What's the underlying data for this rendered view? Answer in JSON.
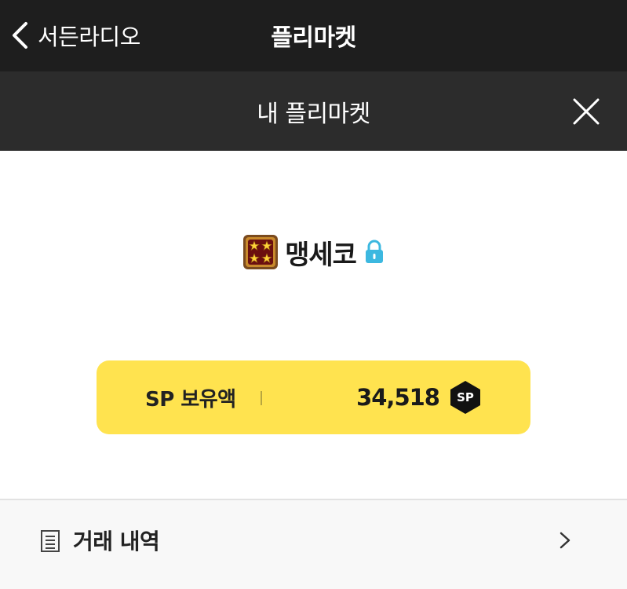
{
  "topbar": {
    "back_label": "서든라디오",
    "title": "플리마켓"
  },
  "subbar": {
    "title": "내 플리마켓"
  },
  "profile": {
    "grade_icon": "four-star-grade-icon",
    "nickname": "맹세코",
    "lock_icon": "lock-icon"
  },
  "sp_card": {
    "label": "SP 보유액",
    "value": "34,518",
    "badge_text": "SP"
  },
  "menu": {
    "history_label": "거래 내역",
    "history_icon": "document-list-icon",
    "chevron_icon": "chevron-right-icon"
  },
  "colors": {
    "topbar_bg": "#1e1e1e",
    "subbar_bg": "#2c2c2c",
    "sp_card_bg": "#ffe34f",
    "lock_color": "#3cb8e0",
    "menu_bg": "#f8f8f8"
  }
}
